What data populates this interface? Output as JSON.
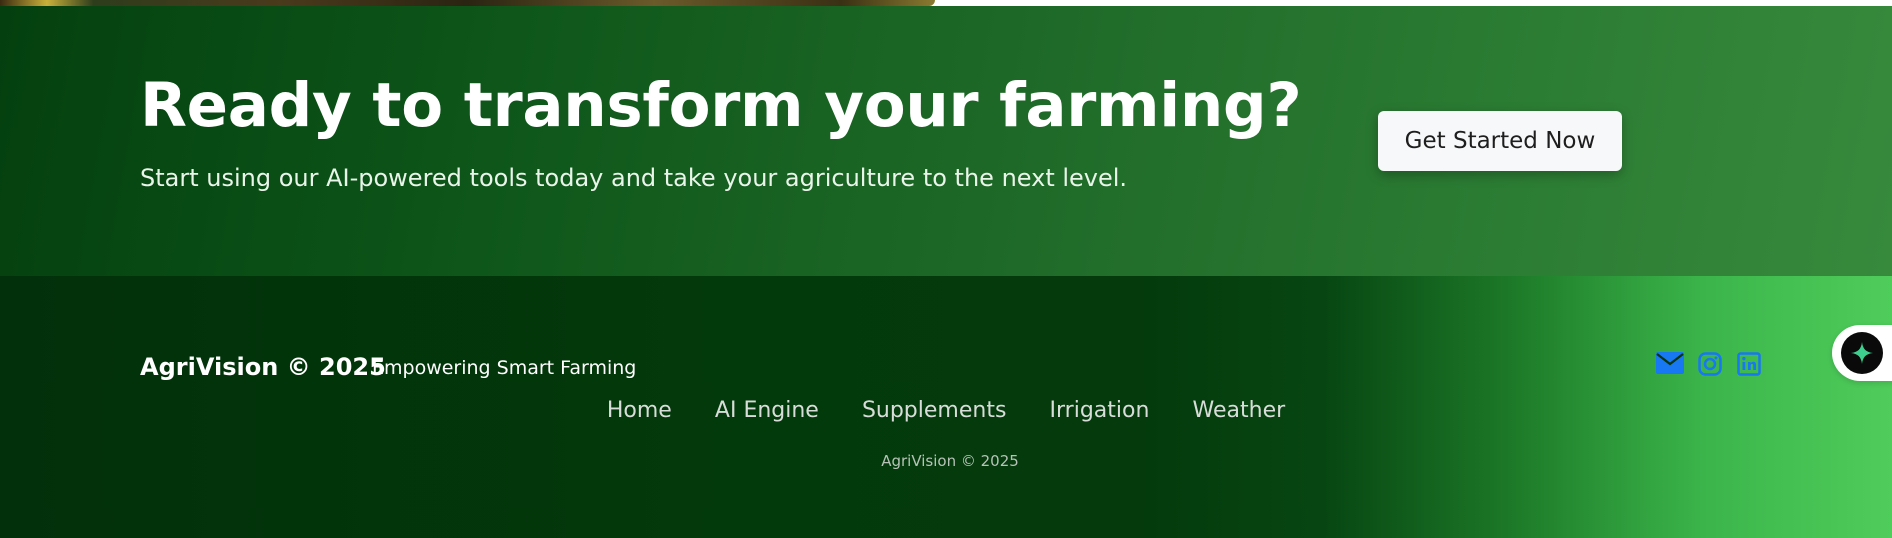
{
  "cta": {
    "title": "Ready to transform your farming?",
    "subtitle": "Start using our AI-powered tools today and take your agriculture to the next level.",
    "button_label": "Get Started Now"
  },
  "footer": {
    "brand": "AgriVision © 2025",
    "tagline": "Empowering Smart Farming",
    "nav": [
      {
        "label": "Home"
      },
      {
        "label": "AI Engine"
      },
      {
        "label": "Supplements"
      },
      {
        "label": "Irrigation"
      },
      {
        "label": "Weather"
      }
    ],
    "copyright": "AgriVision © 2025",
    "social_icons": [
      "mail-icon",
      "instagram-icon",
      "linkedin-icon"
    ]
  },
  "assistant": {
    "icon": "sparkle-icon"
  },
  "colors": {
    "cta_gradient_start": "#04400f",
    "cta_gradient_end": "#378a3c",
    "footer_dark": "#02300a",
    "footer_accent": "#4fcc5b",
    "social_icon": "#1877f2",
    "button_bg": "#f7f8fa"
  }
}
